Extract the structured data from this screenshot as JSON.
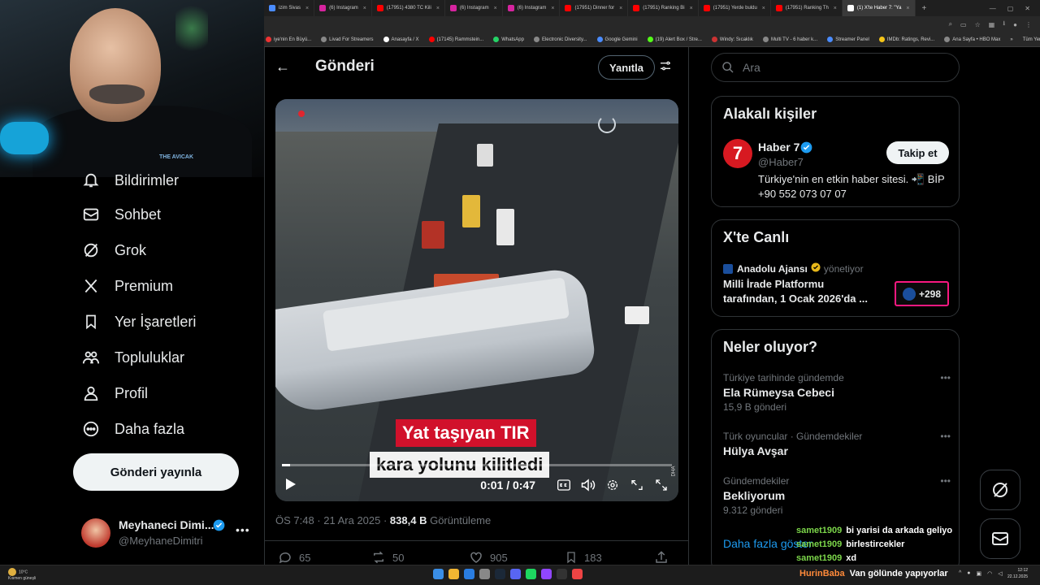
{
  "browser": {
    "tabs": [
      {
        "label": "izim Sivas",
        "color": "#4a8cff"
      },
      {
        "label": "(6) Instagram",
        "color": "#d6249f"
      },
      {
        "label": "(17951) 4380 TC Kili",
        "color": "#ff0000"
      },
      {
        "label": "(6) Instagram",
        "color": "#d6249f"
      },
      {
        "label": "(6) Instagram",
        "color": "#d6249f"
      },
      {
        "label": "(17951) Dinner for",
        "color": "#ff0000"
      },
      {
        "label": "(17951) Ranking Bi",
        "color": "#ff0000"
      },
      {
        "label": "(17951) Yerde buldu",
        "color": "#ff0000"
      },
      {
        "label": "(17951) Ranking Th",
        "color": "#ff0000"
      },
      {
        "label": "(1) X'te Haber 7: \"Ya",
        "color": "#ffffff",
        "active": true
      }
    ],
    "tab_close": "×",
    "new_tab": "+",
    "bookmarks": [
      {
        "label": "iye'nin En Büyü...",
        "color": "#e33"
      },
      {
        "label": "Livad For Streamers",
        "color": "#888"
      },
      {
        "label": "Anasayfa / X",
        "color": "#fff"
      },
      {
        "label": "(17145) Rammstein...",
        "color": "#f00"
      },
      {
        "label": "WhatsApp",
        "color": "#25d366"
      },
      {
        "label": "Electronic Diversity...",
        "color": "#888"
      },
      {
        "label": "Google Gemini",
        "color": "#4a8cff"
      },
      {
        "label": "(19) Alert Box / Stre...",
        "color": "#53fc18"
      },
      {
        "label": "Windy: Sıcaklık",
        "color": "#c33"
      },
      {
        "label": "Multi TV - 6 haber k...",
        "color": "#888"
      },
      {
        "label": "Streamer Panel",
        "color": "#4a8cff"
      },
      {
        "label": "IMDb: Ratings, Revi...",
        "color": "#f5c518"
      },
      {
        "label": "Ana Sayfa • HBO Max",
        "color": "#888"
      }
    ],
    "bookmarks_overflow": "»",
    "all_bookmarks": "Tüm Yer İşaretleri"
  },
  "webcam": {
    "logo_text": "THE AVICAK"
  },
  "nav": {
    "items": [
      {
        "label": "Bildirimler",
        "icon": "bell-icon"
      },
      {
        "label": "Sohbet",
        "icon": "mail-icon"
      },
      {
        "label": "Grok",
        "icon": "grok-icon"
      },
      {
        "label": "Premium",
        "icon": "x-logo-icon"
      },
      {
        "label": "Yer İşaretleri",
        "icon": "bookmark-icon"
      },
      {
        "label": "Topluluklar",
        "icon": "communities-icon"
      },
      {
        "label": "Profil",
        "icon": "profile-icon"
      },
      {
        "label": "Daha fazla",
        "icon": "more-circle-icon"
      }
    ],
    "post_button": "Gönderi yayınla",
    "account": {
      "name": "Meyhaneci Dimi...",
      "handle": "@MeyhaneDimitri",
      "more": "•••"
    }
  },
  "post": {
    "back_label": "←",
    "header_title": "Gönderi",
    "reply_button": "Yanıtla",
    "video": {
      "caption_line1": "Yat taşıyan TIR",
      "caption_line2": "kara yolunu kilitledi",
      "time": "0:01 / 0:47",
      "progress": 0.02,
      "watermark": "DHA"
    },
    "meta": {
      "time": "ÖS 7:48 · 21 Ara 2025 · ",
      "views": "838,4 B",
      "views_label": " Görüntüleme"
    },
    "stats": {
      "replies": "65",
      "reposts": "50",
      "likes": "905",
      "bookmarks": "183"
    }
  },
  "sidebar": {
    "search_placeholder": "Ara",
    "related": {
      "title": "Alakalı kişiler",
      "avatar_text": "7",
      "name": "Haber 7",
      "handle": "@Haber7",
      "bio": "Türkiye'nin en etkin haber sitesi. 📲 BİP +90 552 073 07 07",
      "follow": "Takip et"
    },
    "live": {
      "title": "X'te Canlı",
      "host": "Anadolu Ajansı",
      "role": "yönetiyor",
      "space_title": "Milli İrade Platformu tarafından, 1 Ocak 2026'da ...",
      "listeners": "+298"
    },
    "trends": {
      "title": "Neler oluyor?",
      "items": [
        {
          "context": "Türkiye tarihinde gündemde",
          "name": "Ela Rümeysa Cebeci",
          "count": "15,9 B gönderi"
        },
        {
          "context": "Türk oyuncular · Gündemdekiler",
          "name": "Hülya Avşar",
          "count": ""
        },
        {
          "context": "Gündemdekiler",
          "name": "Bekliyorum",
          "count": "9.312 gönderi"
        }
      ],
      "show_more": "Daha fazla göster",
      "more": "•••"
    }
  },
  "chat": {
    "messages": [
      {
        "user": "samet1909",
        "text": "bi yarisi da arkada geliyo"
      },
      {
        "user": "samet1909",
        "text": "birlestircekler"
      },
      {
        "user": "samet1909",
        "text": "xd"
      }
    ],
    "taskbar_message": {
      "user": "HurinBaba",
      "text": "Van gölünde yapıyorlar"
    }
  },
  "taskbar": {
    "weather_temp": "10°C",
    "weather_desc": "Kısmen güneşli",
    "time": "12:12",
    "date": "22.12.2025",
    "tray_chevron": "^"
  }
}
